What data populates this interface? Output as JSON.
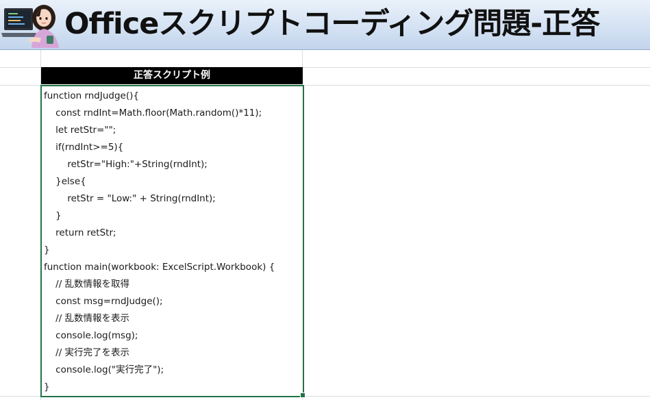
{
  "banner": {
    "title": "Officeスクリプトコーディング問題-正答"
  },
  "table": {
    "header": "正答スクリプト例",
    "lines": [
      "function rndJudge(){",
      "    const rndInt=Math.floor(Math.random()*11);",
      "    let retStr=\"\";",
      "    if(rndInt>=5){",
      "        retStr=\"High:\"+String(rndInt);",
      "    }else{",
      "        retStr = \"Low:\" + String(rndInt);",
      "    }",
      "    return retStr;",
      "}",
      "function main(workbook: ExcelScript.Workbook) {",
      "    // 乱数情報を取得",
      "    const msg=rndJudge();",
      "    // 乱数情報を表示",
      "    console.log(msg);",
      "    // 実行完了を表示",
      "    console.log(\"実行完了\");",
      "}"
    ]
  },
  "colors": {
    "header_bg": "#000000",
    "header_text": "#ffffff",
    "selection_border": "#217346",
    "gridline": "#dadcdf",
    "banner_gradient_top": "#eaf1fa",
    "banner_gradient_bottom": "#c3d5ec"
  },
  "icons": {
    "avatar": "woman-at-laptop-illustration"
  }
}
